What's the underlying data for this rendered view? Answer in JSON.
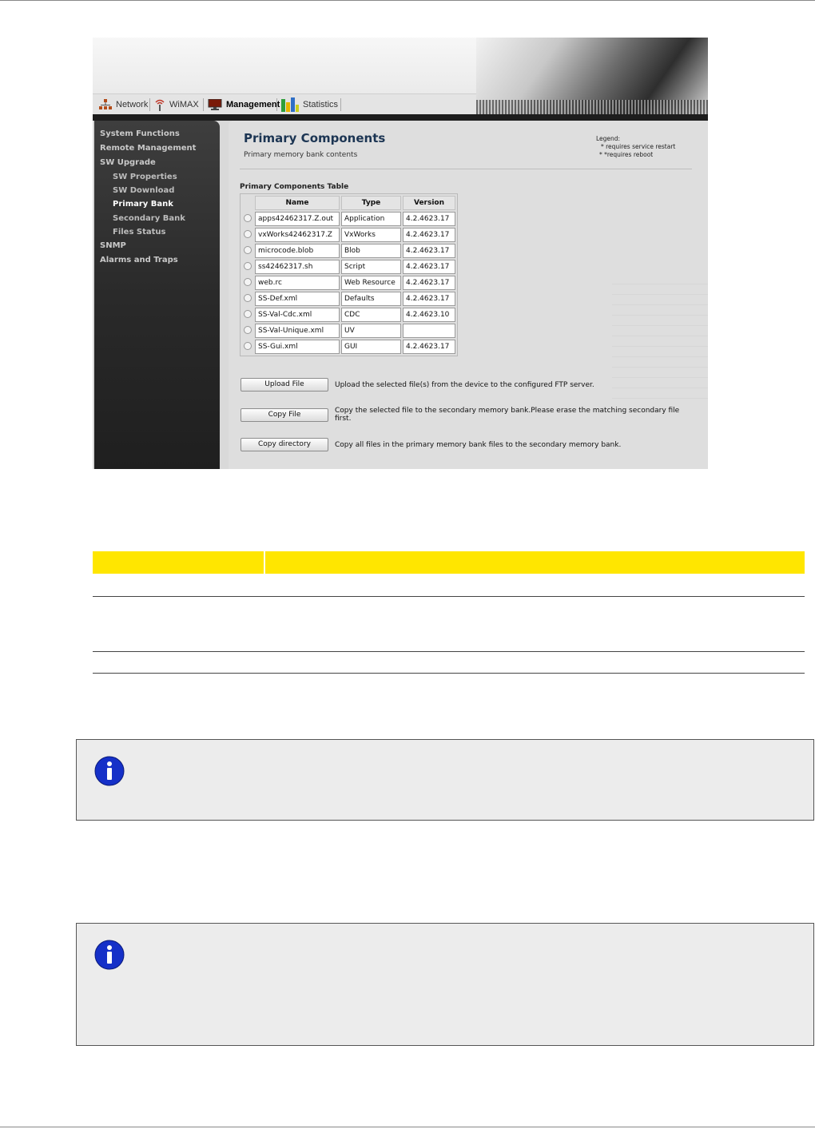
{
  "navbar": {
    "items": [
      {
        "label": "Network",
        "icon": "network-icon"
      },
      {
        "label": "WiMAX",
        "icon": "wimax-icon"
      },
      {
        "label": "Management",
        "icon": "management-icon"
      },
      {
        "label": "Statistics",
        "icon": "statistics-icon"
      }
    ]
  },
  "sidebar": {
    "items": [
      {
        "label": "System Functions"
      },
      {
        "label": "Remote Management"
      },
      {
        "label": "SW Upgrade"
      },
      {
        "label": "SW Properties"
      },
      {
        "label": "SW Download"
      },
      {
        "label": "Primary Bank"
      },
      {
        "label": "Secondary Bank"
      },
      {
        "label": "Files Status"
      },
      {
        "label": "SNMP"
      },
      {
        "label": "Alarms and Traps"
      }
    ]
  },
  "page": {
    "title": "Primary Components",
    "subtitle": "Primary memory bank contents",
    "legend_title": "Legend:",
    "legend_restart": "* requires service restart",
    "legend_reboot": "* *requires reboot"
  },
  "table": {
    "caption": "Primary Components Table",
    "headers": [
      "Name",
      "Type",
      "Version"
    ],
    "rows": [
      {
        "name": "apps42462317.Z.out",
        "type": "Application",
        "version": "4.2.4623.17"
      },
      {
        "name": "vxWorks42462317.Z",
        "type": "VxWorks",
        "version": "4.2.4623.17"
      },
      {
        "name": "microcode.blob",
        "type": "Blob",
        "version": "4.2.4623.17"
      },
      {
        "name": "ss42462317.sh",
        "type": "Script",
        "version": "4.2.4623.17"
      },
      {
        "name": "web.rc",
        "type": "Web Resource",
        "version": "4.2.4623.17"
      },
      {
        "name": "SS-Def.xml",
        "type": "Defaults",
        "version": "4.2.4623.17"
      },
      {
        "name": "SS-Val-Cdc.xml",
        "type": "CDC",
        "version": "4.2.4623.10"
      },
      {
        "name": "SS-Val-Unique.xml",
        "type": "UV",
        "version": ""
      },
      {
        "name": "SS-Gui.xml",
        "type": "GUI",
        "version": "4.2.4623.17"
      }
    ]
  },
  "actions": {
    "upload_label": "Upload File",
    "upload_desc": "Upload the selected file(s) from the device to the configured FTP server.",
    "copy_label": "Copy File",
    "copy_desc": "Copy the selected file to the secondary memory bank.Please erase the matching secondary file first.",
    "copydir_label": "Copy directory",
    "copydir_desc": "Copy all files in the primary memory bank files to the secondary memory bank."
  },
  "colors": {
    "table_header_yellow": "#ffe600",
    "info_icon_blue": "#1530c8"
  }
}
